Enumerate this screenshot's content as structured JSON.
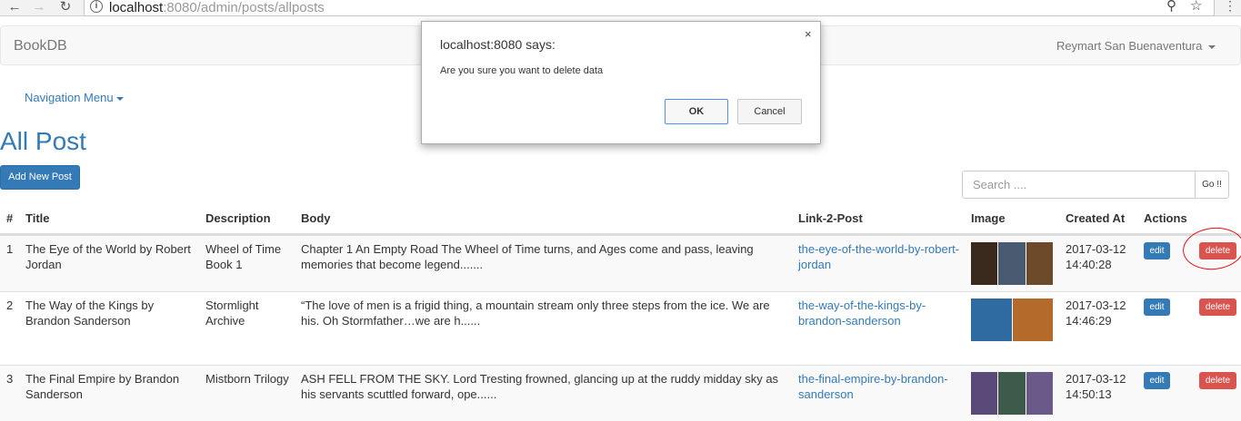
{
  "browser": {
    "back_icon": "arrow-left-icon",
    "forward_icon": "arrow-right-icon",
    "reload_icon": "reload-icon",
    "url_host": "localhost",
    "url_path": ":8080/admin/posts/allposts",
    "zoom_icon": "magnifier-icon",
    "bookmark_icon": "star-icon",
    "menu_icon": "vertical-dots-icon"
  },
  "navbar": {
    "brand": "BookDB",
    "user": "Reymart San Buenaventura"
  },
  "nav_menu": "Navigation Menu",
  "page_title": "All Post",
  "add_button": "Add New Post",
  "search": {
    "placeholder": "Search ....",
    "button": "Go !!"
  },
  "table": {
    "headers": {
      "num": "#",
      "title": "Title",
      "description": "Description",
      "body": "Body",
      "link": "Link-2-Post",
      "image": "Image",
      "created": "Created At",
      "actions": "Actions"
    },
    "rows": [
      {
        "num": "1",
        "title_l1": "The Eye of the World by Robert",
        "title_l2": "Jordan",
        "desc_l1": "Wheel of Time",
        "desc_l2": "Book 1",
        "body_l1": "Chapter 1 An Empty Road The Wheel of Time turns, and Ages come and pass, leaving",
        "body_l2": "memories that become legend.......",
        "link_l1": "the-eye-of-the-world-by-robert-",
        "link_l2": "jordan",
        "date": "2017-03-12",
        "time": "14:40:28",
        "edit": "edit",
        "delete": "delete",
        "thumb_colors": [
          "#3a2a1e",
          "#4a5a70",
          "#6c4a2a"
        ]
      },
      {
        "num": "2",
        "title_l1": "The Way of the Kings by",
        "title_l2": "Brandon Sanderson",
        "desc_l1": "Stormlight",
        "desc_l2": "Archive",
        "body_l1": "“The love of men is a frigid thing, a mountain stream only three steps from the ice. We are",
        "body_l2": "his. Oh Stormfather…we are h......",
        "link_l1": "the-way-of-the-kings-by-",
        "link_l2": "brandon-sanderson",
        "date": "2017-03-12",
        "time": "14:46:29",
        "edit": "edit",
        "delete": "delete",
        "thumb_colors": [
          "#2f6aa0",
          "#b46a2a"
        ]
      },
      {
        "num": "3",
        "title_l1": "The Final Empire by Brandon",
        "title_l2": "Sanderson",
        "desc_l1": "Mistborn Trilogy",
        "desc_l2": "",
        "body_l1": "ASH FELL FROM THE SKY. Lord Tresting frowned, glancing up at the ruddy midday sky as",
        "body_l2": "his servants scuttled forward, ope......",
        "link_l1": "the-final-empire-by-brandon-",
        "link_l2": "sanderson",
        "date": "2017-03-12",
        "time": "14:50:13",
        "edit": "edit",
        "delete": "delete",
        "thumb_colors": [
          "#5a4a7a",
          "#3e5a4a",
          "#6a5a8a"
        ]
      }
    ]
  },
  "dialog": {
    "title": "localhost:8080 says:",
    "message": "Are you sure you want to delete data",
    "ok": "OK",
    "cancel": "Cancel",
    "close": "×"
  },
  "colors": {
    "primary": "#337ab7",
    "danger": "#d9534f",
    "annotation": "#e8101a"
  }
}
